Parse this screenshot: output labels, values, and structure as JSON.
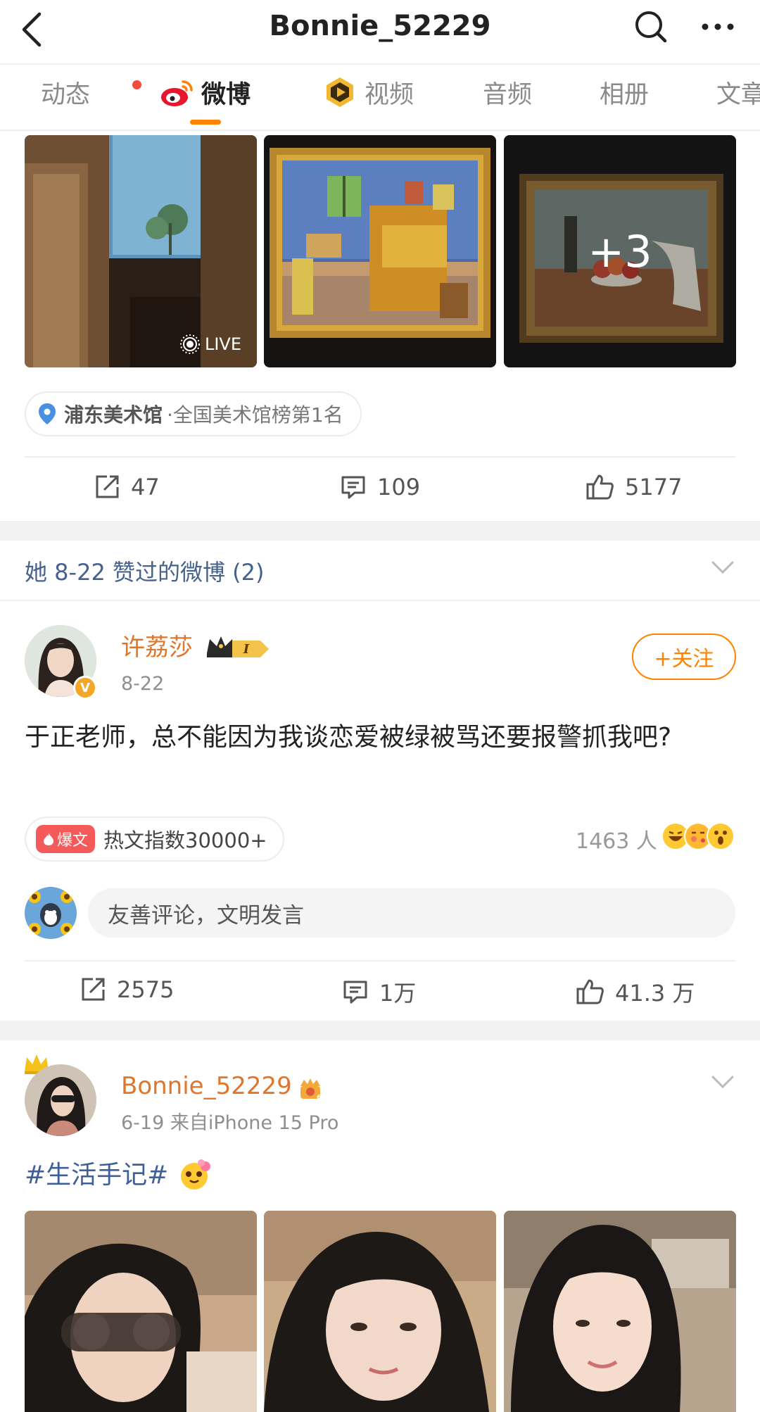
{
  "header": {
    "title": "Bonnie_52229",
    "icons": [
      "back-icon",
      "search-icon",
      "more-icon"
    ]
  },
  "tabs": [
    {
      "label": "动态",
      "has_dot": true
    },
    {
      "label": "微博",
      "active": true
    },
    {
      "label": "视频"
    },
    {
      "label": "音频"
    },
    {
      "label": "相册"
    },
    {
      "label": "文章"
    }
  ],
  "post0": {
    "photos": [
      {
        "description": "window-photo",
        "badge": "LIVE"
      },
      {
        "description": "bedroom-painting"
      },
      {
        "description": "still-life-painting",
        "more_count": "+3"
      }
    ],
    "location": {
      "name": "浦东美术馆",
      "rank": "·全国美术馆榜第1名"
    },
    "actions": {
      "repost": "47",
      "comment": "109",
      "like": "5177"
    }
  },
  "liked_section": {
    "title": "她 8-22 赞过的微博 (2)"
  },
  "post1": {
    "author": "许荔莎",
    "date": "8-22",
    "follow_label": "+关注",
    "text": "于正老师，总不能因为我谈恋爱被绿被骂还要报警抓我吧?",
    "hot_badge": "爆文",
    "hot_text": "热文指数30000+",
    "reactions_count": "1463 人",
    "comment_placeholder": "友善评论，文明发言",
    "actions": {
      "repost": "2575",
      "comment": "1万",
      "like": "41.3 万"
    }
  },
  "post2": {
    "author": "Bonnie_52229",
    "meta": "6-19 来自iPhone 15 Pro",
    "hashtag": "#生活手记#"
  },
  "colors": {
    "accent_orange": "#ff8200",
    "link_blue": "#3d5f9a",
    "author_orange": "#e0762b"
  }
}
